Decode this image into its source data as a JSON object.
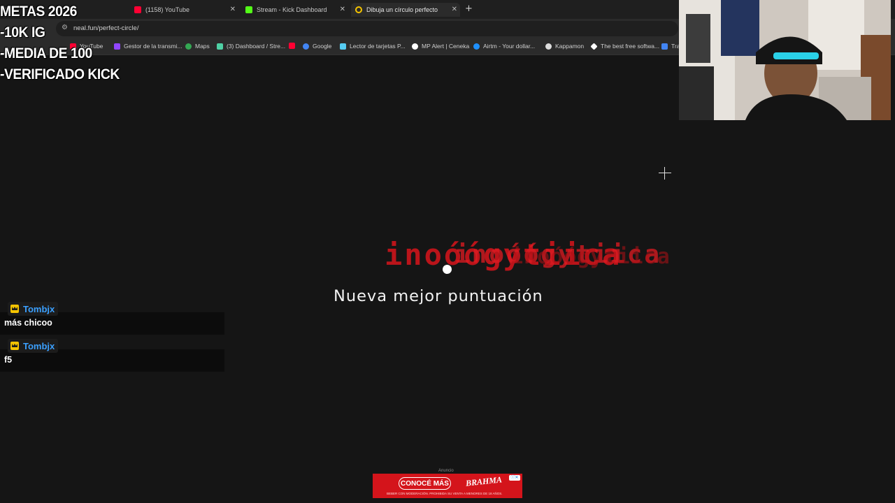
{
  "browser": {
    "tabs": [
      {
        "title": "(1158) YouTube",
        "color": "#ff0033"
      },
      {
        "title": "Stream - Kick Dashboard",
        "color": "#53fc18"
      },
      {
        "title": "Dibuja un círculo perfecto",
        "color": "#f5c400"
      }
    ],
    "new_tab": "+",
    "url": "neal.fun/perfect-circle/",
    "bookmarks": [
      {
        "label": "YouTube",
        "color": "#ff0033"
      },
      {
        "label": "Gestor de la transmi...",
        "color": "#9146ff"
      },
      {
        "label": "Maps",
        "color": "#34a853"
      },
      {
        "label": "(3) Dashboard / Stre...",
        "color": "#4fd1a5"
      },
      {
        "label": "",
        "color": "#ff0033"
      },
      {
        "label": "Google",
        "color": "#4285f4"
      },
      {
        "label": "Lector de tarjetas P...",
        "color": "#56ccf2"
      },
      {
        "label": "MP Alert | Ceneka",
        "color": "#ffffff"
      },
      {
        "label": "Airtm - Your dollar...",
        "color": "#1e90ff"
      },
      {
        "label": "Kappamon",
        "color": "#dddddd"
      },
      {
        "label": "The best free softwa...",
        "color": "#ffffff"
      },
      {
        "label": "Tra",
        "color": "#4285f4"
      }
    ]
  },
  "overlay": {
    "goals": [
      "METAS 2026",
      "-10K IG",
      "-MEDIA DE 100",
      "-VERIFICADO KICK"
    ]
  },
  "game": {
    "score_glitch": "inoóógytiica",
    "best_score_text": "Nueva mejor puntuación"
  },
  "chat": [
    {
      "user": "Tombjx",
      "message": "más chicoo"
    },
    {
      "user": "Tombjx",
      "message": "f5"
    }
  ],
  "ad": {
    "label": "Anuncio",
    "cta": "CONOCÉ MÁS",
    "brand": "BRAHMA",
    "legal": "BEBER CON MODERACIÓN. PROHIBIDA SU VENTA A MENORES DE 18 AÑOS."
  }
}
